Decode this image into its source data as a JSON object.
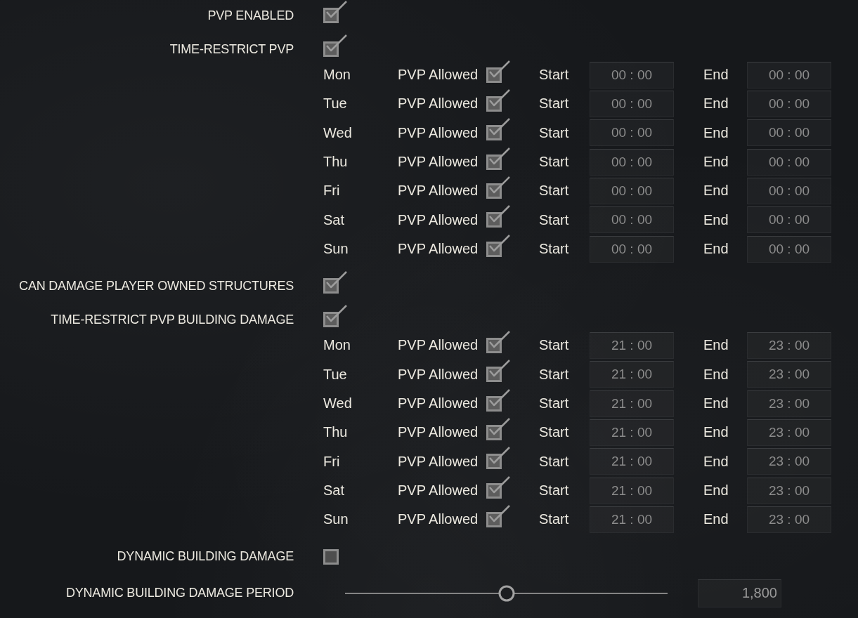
{
  "settings": [
    {
      "kind": "checkbox",
      "label": "PVP ENABLED",
      "checked": true
    },
    {
      "kind": "checkbox",
      "label": "TIME-RESTRICT PVP",
      "checked": true,
      "schedule": [
        {
          "day": "Mon",
          "allowed_label": "PVP Allowed",
          "allowed": true,
          "start_label": "Start",
          "start": "00 : 00",
          "end_label": "End",
          "end": "00 : 00"
        },
        {
          "day": "Tue",
          "allowed_label": "PVP Allowed",
          "allowed": true,
          "start_label": "Start",
          "start": "00 : 00",
          "end_label": "End",
          "end": "00 : 00"
        },
        {
          "day": "Wed",
          "allowed_label": "PVP Allowed",
          "allowed": true,
          "start_label": "Start",
          "start": "00 : 00",
          "end_label": "End",
          "end": "00 : 00"
        },
        {
          "day": "Thu",
          "allowed_label": "PVP Allowed",
          "allowed": true,
          "start_label": "Start",
          "start": "00 : 00",
          "end_label": "End",
          "end": "00 : 00"
        },
        {
          "day": "Fri",
          "allowed_label": "PVP Allowed",
          "allowed": true,
          "start_label": "Start",
          "start": "00 : 00",
          "end_label": "End",
          "end": "00 : 00"
        },
        {
          "day": "Sat",
          "allowed_label": "PVP Allowed",
          "allowed": true,
          "start_label": "Start",
          "start": "00 : 00",
          "end_label": "End",
          "end": "00 : 00"
        },
        {
          "day": "Sun",
          "allowed_label": "PVP Allowed",
          "allowed": true,
          "start_label": "Start",
          "start": "00 : 00",
          "end_label": "End",
          "end": "00 : 00"
        }
      ]
    },
    {
      "kind": "checkbox",
      "label": "CAN DAMAGE PLAYER OWNED STRUCTURES",
      "checked": true
    },
    {
      "kind": "checkbox",
      "label": "TIME-RESTRICT PVP BUILDING DAMAGE",
      "checked": true,
      "schedule": [
        {
          "day": "Mon",
          "allowed_label": "PVP Allowed",
          "allowed": true,
          "start_label": "Start",
          "start": "21 : 00",
          "end_label": "End",
          "end": "23 : 00"
        },
        {
          "day": "Tue",
          "allowed_label": "PVP Allowed",
          "allowed": true,
          "start_label": "Start",
          "start": "21 : 00",
          "end_label": "End",
          "end": "23 : 00"
        },
        {
          "day": "Wed",
          "allowed_label": "PVP Allowed",
          "allowed": true,
          "start_label": "Start",
          "start": "21 : 00",
          "end_label": "End",
          "end": "23 : 00"
        },
        {
          "day": "Thu",
          "allowed_label": "PVP Allowed",
          "allowed": true,
          "start_label": "Start",
          "start": "21 : 00",
          "end_label": "End",
          "end": "23 : 00"
        },
        {
          "day": "Fri",
          "allowed_label": "PVP Allowed",
          "allowed": true,
          "start_label": "Start",
          "start": "21 : 00",
          "end_label": "End",
          "end": "23 : 00"
        },
        {
          "day": "Sat",
          "allowed_label": "PVP Allowed",
          "allowed": true,
          "start_label": "Start",
          "start": "21 : 00",
          "end_label": "End",
          "end": "23 : 00"
        },
        {
          "day": "Sun",
          "allowed_label": "PVP Allowed",
          "allowed": true,
          "start_label": "Start",
          "start": "21 : 00",
          "end_label": "End",
          "end": "23 : 00"
        }
      ]
    },
    {
      "kind": "checkbox",
      "label": "DYNAMIC BUILDING DAMAGE",
      "checked": false
    },
    {
      "kind": "slider",
      "label": "DYNAMIC BUILDING DAMAGE PERIOD",
      "level": 0.5,
      "value": "1,800"
    }
  ]
}
